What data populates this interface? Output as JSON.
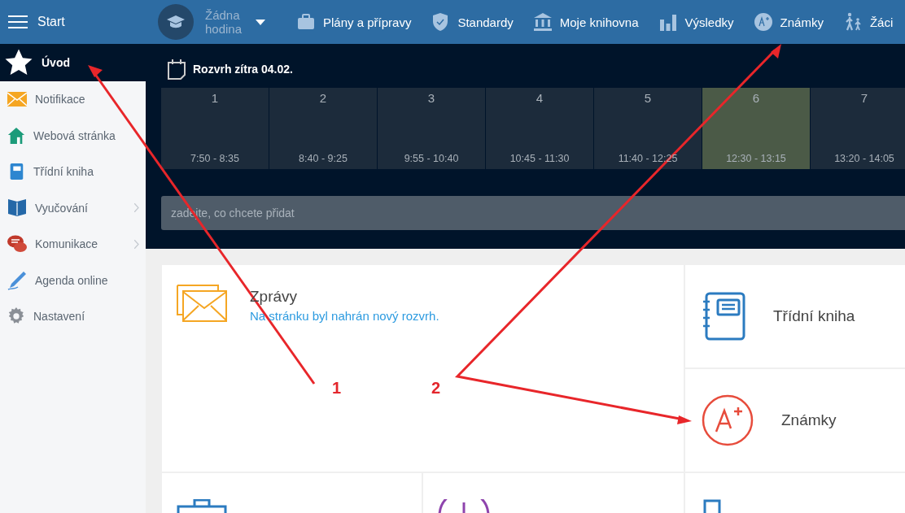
{
  "topbar": {
    "menu_label": "Start",
    "lesson": {
      "label": "Žádna hodina"
    },
    "nav": [
      {
        "kind": "briefcase",
        "label": "Plány a přípravy"
      },
      {
        "kind": "shield",
        "label": "Standardy"
      },
      {
        "kind": "bank",
        "label": "Moje knihovna"
      },
      {
        "kind": "bars",
        "label": "Výsledky"
      },
      {
        "kind": "grade",
        "label": "Známky"
      },
      {
        "kind": "walkers",
        "label": "Žáci"
      }
    ]
  },
  "sidebar": {
    "items": [
      {
        "kind": "star",
        "label": "Úvod",
        "selected": true,
        "submenu": false
      },
      {
        "kind": "mail",
        "label": "Notifikace",
        "selected": false,
        "submenu": false
      },
      {
        "kind": "house",
        "label": "Webová stránka",
        "selected": false,
        "submenu": false
      },
      {
        "kind": "notebook",
        "label": "Třídní kniha",
        "selected": false,
        "submenu": false
      },
      {
        "kind": "book",
        "label": "Vyučování",
        "selected": false,
        "submenu": true
      },
      {
        "kind": "chat",
        "label": "Komunikace",
        "selected": false,
        "submenu": true
      },
      {
        "kind": "pen",
        "label": "Agenda online",
        "selected": false,
        "submenu": false
      },
      {
        "kind": "gear",
        "label": "Nastavení",
        "selected": false,
        "submenu": false
      }
    ]
  },
  "timetable": {
    "title": "Rozvrh zítra 04.02.",
    "periods": [
      {
        "number": "1",
        "time": "7:50 - 8:35",
        "selected": false
      },
      {
        "number": "2",
        "time": "8:40 - 9:25",
        "selected": false
      },
      {
        "number": "3",
        "time": "9:55 - 10:40",
        "selected": false
      },
      {
        "number": "4",
        "time": "10:45 - 11:30",
        "selected": false
      },
      {
        "number": "5",
        "time": "11:40 - 12:25",
        "selected": false
      },
      {
        "number": "6",
        "time": "12:30 - 13:15",
        "selected": true
      },
      {
        "number": "7",
        "time": "13:20 - 14:05",
        "selected": false
      }
    ]
  },
  "quick_add": {
    "placeholder": "zadejte, co chcete přidat"
  },
  "cards": [
    {
      "kind": "messages",
      "title": "Zprávy",
      "subtitle": "Na stránku byl nahrán nový rozvrh."
    },
    {
      "kind": "notebook",
      "title": "Třídní kniha"
    },
    {
      "kind": "grade",
      "title": "Známky"
    },
    {
      "kind": "briefcase"
    },
    {
      "kind": "clock"
    },
    {
      "kind": "phone"
    }
  ],
  "annotations": [
    {
      "label": "1"
    },
    {
      "label": "2"
    }
  ]
}
